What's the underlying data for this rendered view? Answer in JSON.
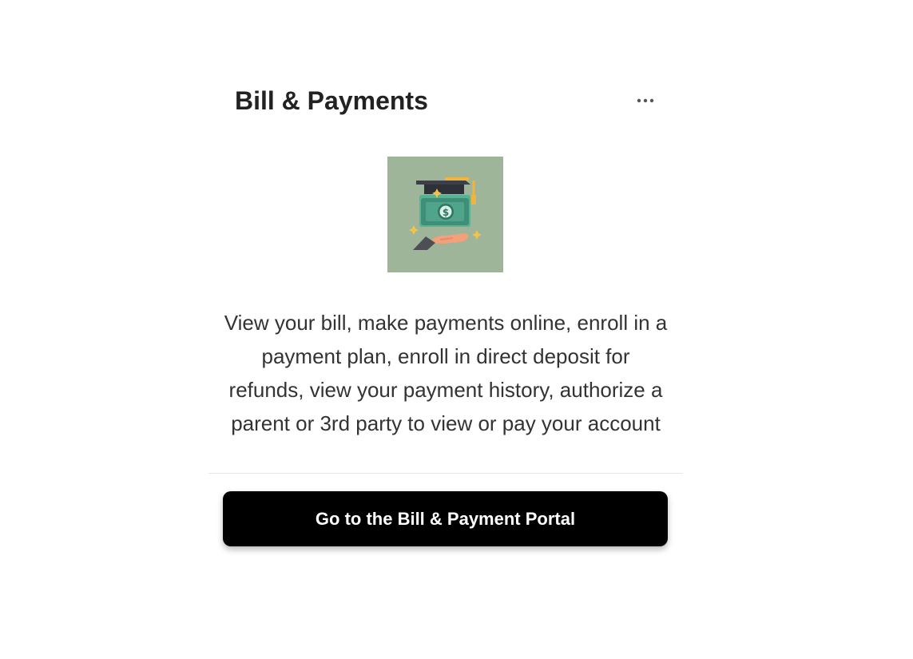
{
  "card": {
    "title": "Bill & Payments",
    "more_icon": "more-horizontal-icon",
    "image_icon": "tuition-payment-icon",
    "description": "View your bill, make payments online, enroll in a payment plan, enroll in direct deposit for refunds, view your payment history, authorize a parent or 3rd party to view or pay your account",
    "button_label": "Go to the Bill & Payment Portal"
  },
  "colors": {
    "button_bg": "#000000",
    "button_text": "#ffffff",
    "title": "#222222",
    "body_text": "#333333",
    "image_bg": "#9eb59a",
    "money_green": "#4a9b83",
    "divider": "#e6e6e6"
  }
}
